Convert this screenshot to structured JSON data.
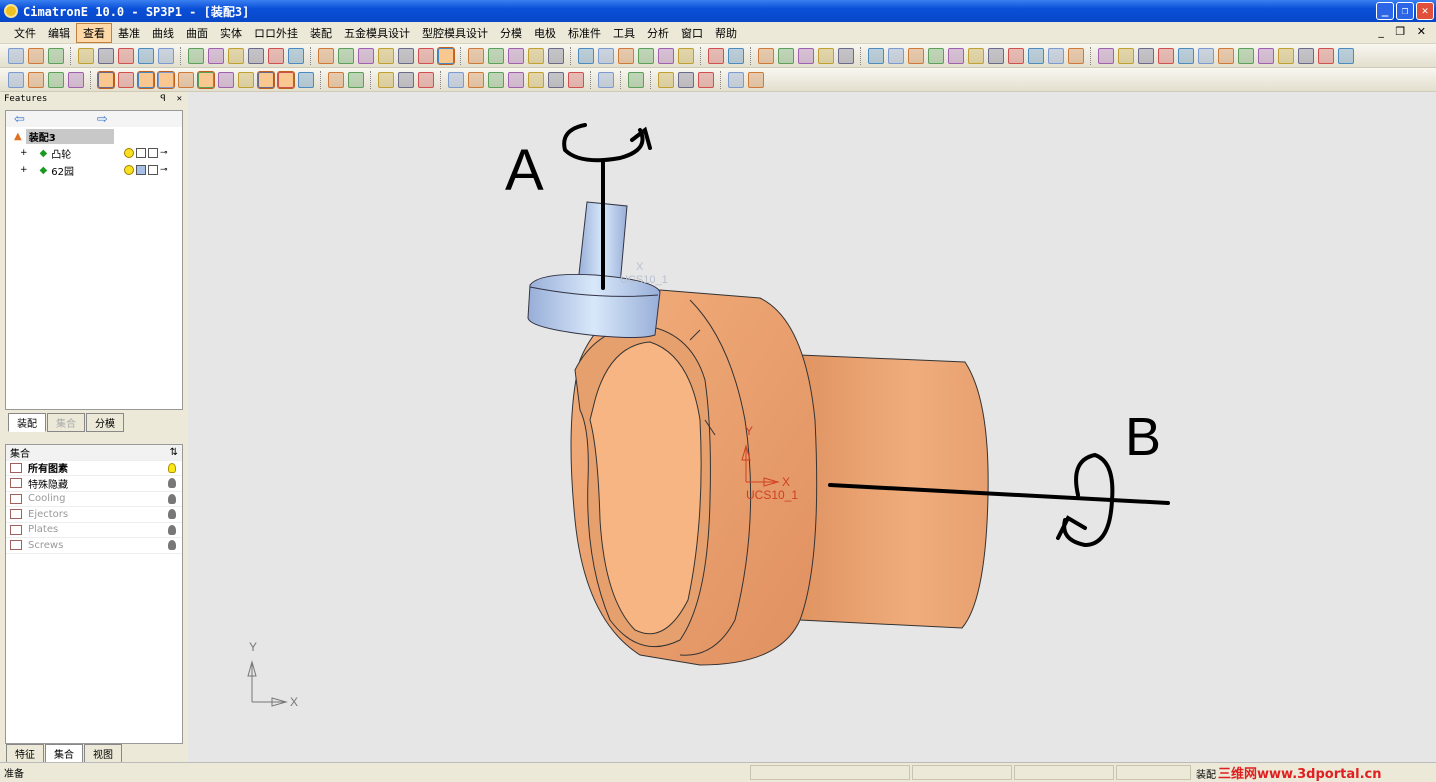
{
  "window": {
    "title": "CimatronE 10.0 - SP3P1 - [装配3]",
    "buttons": [
      "_",
      "❐",
      "✕"
    ]
  },
  "menu": {
    "items": [
      "文件",
      "编辑",
      "查看",
      "基准",
      "曲线",
      "曲面",
      "实体",
      "ロロ外挂",
      "装配",
      "五金模具设计",
      "型腔模具设计",
      "分模",
      "电极",
      "标准件",
      "工具",
      "分析",
      "窗口",
      "帮助"
    ],
    "active": "查看",
    "mdi": "_ ❐ ✕"
  },
  "toolbars": {
    "row1": [
      "new-file",
      "open-folder",
      "save",
      "|",
      "undo",
      "redo",
      "glasses",
      "rebuild",
      "regen",
      "|",
      "zoom-all",
      "zoom-window",
      "zoom-box",
      "zoom",
      "pan",
      "rotate",
      "|",
      "shaded-view",
      "wire-view-1",
      "wire-view-2",
      "wire-view-3",
      "wire-view-4",
      "wire-view-5",
      "wire-view-6",
      "|",
      "section",
      "hide",
      "box-view",
      "render-mode",
      "display-mode",
      "|",
      "ucs",
      "mirror",
      "symmetry",
      "bulb-off",
      "bulb-on",
      "bulb-dim",
      "|",
      "arrow-left",
      "arrow-right",
      "|",
      "distance",
      "measure",
      "wizard",
      "paste",
      "combine",
      "|",
      "plane",
      "point",
      "grid",
      "points",
      "mirror-plane",
      "color-table",
      "paint",
      "pen",
      "lines",
      "thick-lines",
      "cube",
      "|",
      "line",
      "line2",
      "circle",
      "curve",
      "plane-sketch",
      "cross",
      "hide-curve",
      "split",
      "axes",
      "pointer",
      "frame",
      "xyz",
      "ratio"
    ],
    "row2": [
      "select-delete",
      "cancel-select",
      "select-filter",
      "select-mode",
      "|",
      "filter-1",
      "filter-2",
      "filter-3",
      "filter-4",
      "filter-x",
      "filter-5",
      "filter-6",
      "filter-7",
      "filter-8",
      "filter-9",
      "swap",
      "|",
      "tool-a",
      "tool-b",
      "|",
      "asm-1",
      "asm-2",
      "asm-3",
      "|",
      "add-comp-1",
      "add-comp-2",
      "add-comp-3",
      "add-comp-4",
      "add-comp-5",
      "grid-comp",
      "pair",
      "|",
      "box-3d",
      "|",
      "move",
      "|",
      "insert",
      "connect",
      "play",
      "|",
      "check",
      "flag"
    ],
    "row1_on": [
      "wire-view-6"
    ],
    "row2_on": [
      "filter-1",
      "filter-3",
      "filter-4",
      "filter-5",
      "filter-8",
      "filter-9"
    ]
  },
  "features_panel": {
    "title": "Features",
    "pin": "ꟼ",
    "close": "✕",
    "root": "装配3",
    "items": [
      {
        "label": "凸轮"
      },
      {
        "label": "62园"
      }
    ],
    "tabs": [
      "装配",
      "集合",
      "分模"
    ]
  },
  "collections_panel": {
    "header": "集合",
    "rows": [
      {
        "label": "所有图素",
        "bold": true,
        "on": true
      },
      {
        "label": "特殊隐藏",
        "bold": false,
        "on": false
      },
      {
        "label": "Cooling",
        "dim": true
      },
      {
        "label": "Ejectors",
        "dim": true
      },
      {
        "label": "Plates",
        "dim": true
      },
      {
        "label": "Screws",
        "dim": true
      }
    ],
    "bottom_tabs": [
      "特征",
      "集合",
      "视图"
    ]
  },
  "viewport": {
    "ucs_label": "UCS10_1",
    "ucs_label_ghost": "UCS10_1",
    "axis_x": "X",
    "axis_y": "Y",
    "annotation_a": "A",
    "annotation_b": "B",
    "colors": {
      "background": "#e6e6e6",
      "part": "#e8a070",
      "follower": "#b8cbe8",
      "ucs": "#d04020",
      "ink": "#000000"
    }
  },
  "status": {
    "text": "准备",
    "mode": "装配",
    "watermark": "三维网www.3dportal.cn"
  }
}
